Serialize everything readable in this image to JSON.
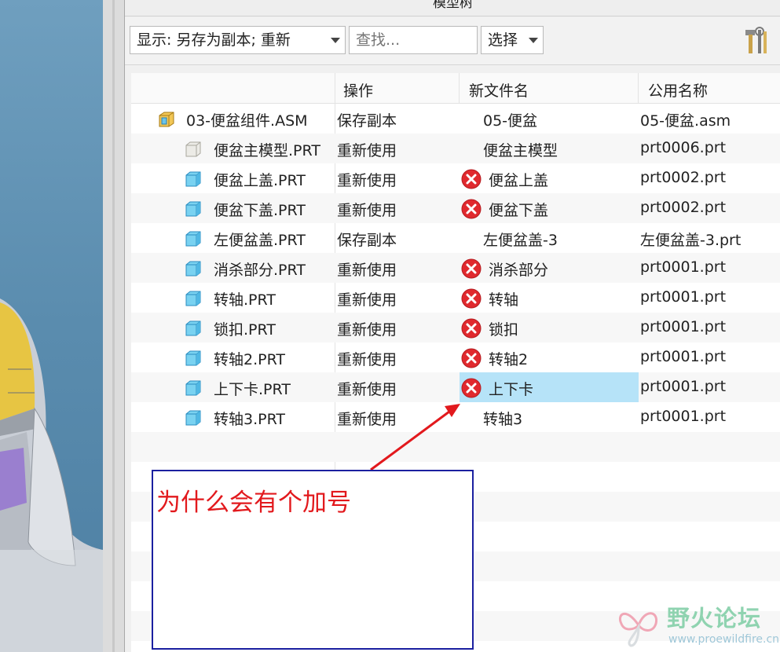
{
  "dialog": {
    "title": "模型树"
  },
  "toolbar": {
    "display_combo": "显示: 另存为副本; 重新",
    "search_placeholder": "查找...",
    "select_combo": "选择",
    "tools_icon": "hammer-wrench-icon"
  },
  "table": {
    "columns": [
      "操作",
      "新文件名",
      "公用名称"
    ],
    "rows": [
      {
        "name": "03-便盆组件.ASM",
        "operation": "保存副本",
        "new_name": "05-便盆",
        "common_name": "05-便盆.asm",
        "icon": "assembly-icon",
        "error": false,
        "selected": false
      },
      {
        "name": "便盆主模型.PRT",
        "operation": "重新使用",
        "new_name": "便盆主模型",
        "common_name": "prt0006.prt",
        "icon": "skeleton-part-icon",
        "error": false,
        "selected": false
      },
      {
        "name": "便盆上盖.PRT",
        "operation": "重新使用",
        "new_name": "便盆上盖",
        "common_name": "prt0002.prt",
        "icon": "part-icon",
        "error": true,
        "selected": false
      },
      {
        "name": "便盆下盖.PRT",
        "operation": "重新使用",
        "new_name": "便盆下盖",
        "common_name": "prt0002.prt",
        "icon": "part-icon",
        "error": true,
        "selected": false
      },
      {
        "name": "左便盆盖.PRT",
        "operation": "保存副本",
        "new_name": "左便盆盖-3",
        "common_name": "左便盆盖-3.prt",
        "icon": "part-icon",
        "error": false,
        "selected": false
      },
      {
        "name": "消杀部分.PRT",
        "operation": "重新使用",
        "new_name": "消杀部分",
        "common_name": "prt0001.prt",
        "icon": "part-icon",
        "error": true,
        "selected": false
      },
      {
        "name": "转轴.PRT",
        "operation": "重新使用",
        "new_name": "转轴",
        "common_name": "prt0001.prt",
        "icon": "part-icon",
        "error": true,
        "selected": false
      },
      {
        "name": "锁扣.PRT",
        "operation": "重新使用",
        "new_name": "锁扣",
        "common_name": "prt0001.prt",
        "icon": "part-icon",
        "error": true,
        "selected": false
      },
      {
        "name": "转轴2.PRT",
        "operation": "重新使用",
        "new_name": "转轴2",
        "common_name": "prt0001.prt",
        "icon": "part-icon",
        "error": true,
        "selected": false
      },
      {
        "name": "上下卡.PRT",
        "operation": "重新使用",
        "new_name": "上下卡",
        "common_name": "prt0001.prt",
        "icon": "part-icon",
        "error": true,
        "selected": true
      },
      {
        "name": "转轴3.PRT",
        "operation": "重新使用",
        "new_name": "转轴3",
        "common_name": "prt0001.prt",
        "icon": "part-icon",
        "error": false,
        "selected": false
      }
    ]
  },
  "annotation": {
    "text": "为什么会有个加号",
    "color": "#e2191d"
  },
  "watermark": {
    "title": "野火论坛",
    "url": "www.proewildfire.cn"
  },
  "colors": {
    "selection": "#b6e3f8",
    "error_red": "#e0292e",
    "note_border": "#1b20a0"
  }
}
